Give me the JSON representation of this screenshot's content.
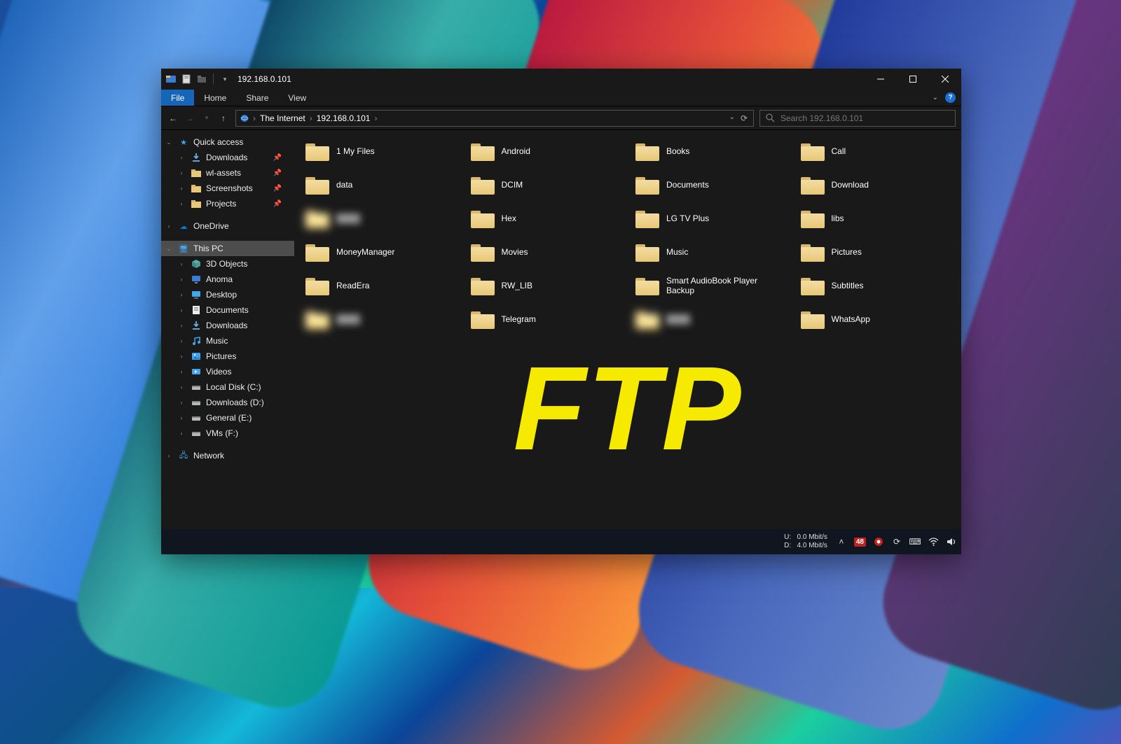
{
  "titlebar": {
    "title": "192.168.0.101"
  },
  "ribbon": {
    "file": "File",
    "home": "Home",
    "share": "Share",
    "view": "View"
  },
  "breadcrumb": {
    "root": "The Internet",
    "sep": "›",
    "loc": "192.168.0.101"
  },
  "search": {
    "placeholder": "Search 192.168.0.101"
  },
  "sidebar": {
    "quick_access": "Quick access",
    "quick_items": [
      {
        "label": "Downloads",
        "pinned": true,
        "icon": "download"
      },
      {
        "label": "wl-assets",
        "pinned": true,
        "icon": "folder"
      },
      {
        "label": "Screenshots",
        "pinned": true,
        "icon": "folder"
      },
      {
        "label": "Projects",
        "pinned": true,
        "icon": "folder"
      }
    ],
    "onedrive": "OneDrive",
    "this_pc": "This PC",
    "pc_items": [
      {
        "label": "3D Objects",
        "icon": "cube"
      },
      {
        "label": "Anoma",
        "icon": "monitor"
      },
      {
        "label": "Desktop",
        "icon": "desktop"
      },
      {
        "label": "Documents",
        "icon": "doc"
      },
      {
        "label": "Downloads",
        "icon": "download"
      },
      {
        "label": "Music",
        "icon": "music"
      },
      {
        "label": "Pictures",
        "icon": "picture"
      },
      {
        "label": "Videos",
        "icon": "video"
      },
      {
        "label": "Local Disk (C:)",
        "icon": "drive"
      },
      {
        "label": "Downloads (D:)",
        "icon": "drive"
      },
      {
        "label": "General (E:)",
        "icon": "drive"
      },
      {
        "label": "VMs (F:)",
        "icon": "drive"
      }
    ],
    "network": "Network"
  },
  "folders": [
    {
      "label": "1 My Files"
    },
    {
      "label": "Android"
    },
    {
      "label": "Books"
    },
    {
      "label": "Call"
    },
    {
      "label": "data"
    },
    {
      "label": "DCIM"
    },
    {
      "label": "Documents"
    },
    {
      "label": "Download"
    },
    {
      "label": "",
      "blur": true
    },
    {
      "label": "Hex"
    },
    {
      "label": "LG TV Plus"
    },
    {
      "label": "libs"
    },
    {
      "label": "MoneyManager"
    },
    {
      "label": "Movies"
    },
    {
      "label": "Music"
    },
    {
      "label": "Pictures"
    },
    {
      "label": "ReadEra"
    },
    {
      "label": "RW_LIB"
    },
    {
      "label": "Smart AudioBook Player Backup"
    },
    {
      "label": "Subtitles"
    },
    {
      "label": "",
      "blur": true
    },
    {
      "label": "Telegram"
    },
    {
      "label": "",
      "blur": true
    },
    {
      "label": "WhatsApp"
    }
  ],
  "overlay": "FTP",
  "taskbar": {
    "up_label": "U:",
    "up_rate": "0.0 Mbit/s",
    "down_label": "D:",
    "down_rate": "4.0 Mbit/s",
    "badge": "48"
  }
}
